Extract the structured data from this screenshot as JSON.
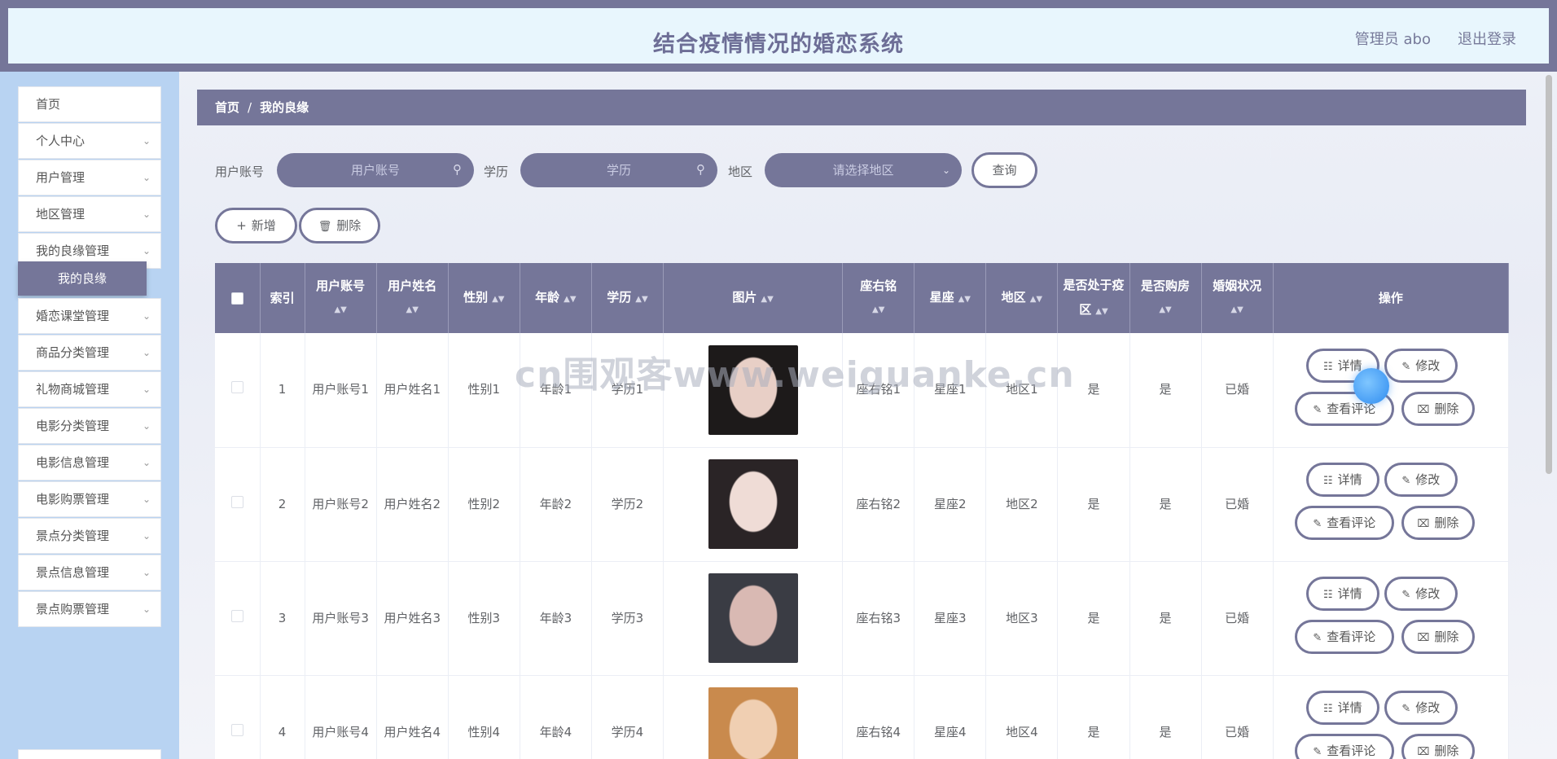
{
  "header": {
    "title": "结合疫情情况的婚恋系统",
    "user": "管理员 abo",
    "logout": "退出登录"
  },
  "sidebar": {
    "items": [
      {
        "label": "首页",
        "has_children": false
      },
      {
        "label": "个人中心",
        "has_children": true
      },
      {
        "label": "用户管理",
        "has_children": true
      },
      {
        "label": "地区管理",
        "has_children": true
      },
      {
        "label": "我的良缘管理",
        "has_children": true
      },
      {
        "label": "婚恋课堂管理",
        "has_children": true
      },
      {
        "label": "商品分类管理",
        "has_children": true
      },
      {
        "label": "礼物商城管理",
        "has_children": true
      },
      {
        "label": "电影分类管理",
        "has_children": true
      },
      {
        "label": "电影信息管理",
        "has_children": true
      },
      {
        "label": "电影购票管理",
        "has_children": true
      },
      {
        "label": "景点分类管理",
        "has_children": true
      },
      {
        "label": "景点信息管理",
        "has_children": true
      },
      {
        "label": "景点购票管理",
        "has_children": true
      }
    ],
    "active_sub": "我的良缘"
  },
  "breadcrumb": {
    "home": "首页",
    "separator": "/",
    "current": "我的良缘"
  },
  "search": {
    "account_label": "用户账号",
    "account_placeholder": "用户账号",
    "edu_label": "学历",
    "edu_placeholder": "学历",
    "region_label": "地区",
    "region_placeholder": "请选择地区",
    "query_button": "查询"
  },
  "actions": {
    "add": "新增",
    "delete": "删除"
  },
  "table": {
    "columns": [
      "索引",
      "用户账号",
      "用户姓名",
      "性别",
      "年龄",
      "学历",
      "图片",
      "座右铭",
      "星座",
      "地区",
      "是否处于疫区",
      "是否购房",
      "婚姻状况",
      "操作"
    ],
    "row_actions": {
      "detail": "详情",
      "edit": "修改",
      "comments": "查看评论",
      "delete": "删除"
    },
    "rows": [
      {
        "index": "1",
        "account": "用户账号1",
        "name": "用户姓名1",
        "gender": "性别1",
        "age": "年龄1",
        "edu": "学历1",
        "motto": "座右铭1",
        "sign": "星座1",
        "region": "地区1",
        "epidemic": "是",
        "house": "是",
        "marital": "已婚",
        "photo_hair": "#1d1a1a",
        "photo_skin": "#e8cfc6"
      },
      {
        "index": "2",
        "account": "用户账号2",
        "name": "用户姓名2",
        "gender": "性别2",
        "age": "年龄2",
        "edu": "学历2",
        "motto": "座右铭2",
        "sign": "星座2",
        "region": "地区2",
        "epidemic": "是",
        "house": "是",
        "marital": "已婚",
        "photo_hair": "#2a2426",
        "photo_skin": "#efdcd6"
      },
      {
        "index": "3",
        "account": "用户账号3",
        "name": "用户姓名3",
        "gender": "性别3",
        "age": "年龄3",
        "edu": "学历3",
        "motto": "座右铭3",
        "sign": "星座3",
        "region": "地区3",
        "epidemic": "是",
        "house": "是",
        "marital": "已婚",
        "photo_hair": "#3a3c44",
        "photo_skin": "#d9b9b3"
      },
      {
        "index": "4",
        "account": "用户账号4",
        "name": "用户姓名4",
        "gender": "性别4",
        "age": "年龄4",
        "edu": "学历4",
        "motto": "座右铭4",
        "sign": "星座4",
        "region": "地区4",
        "epidemic": "是",
        "house": "是",
        "marital": "已婚",
        "photo_hair": "#c98a4d",
        "photo_skin": "#f0cfb2"
      }
    ]
  },
  "watermark": "cn围观客www.weiguanke.cn",
  "colors": {
    "primary": "#757699",
    "header_bg": "#e8f6fd",
    "sidebar_bg": "#b8d3f2"
  }
}
